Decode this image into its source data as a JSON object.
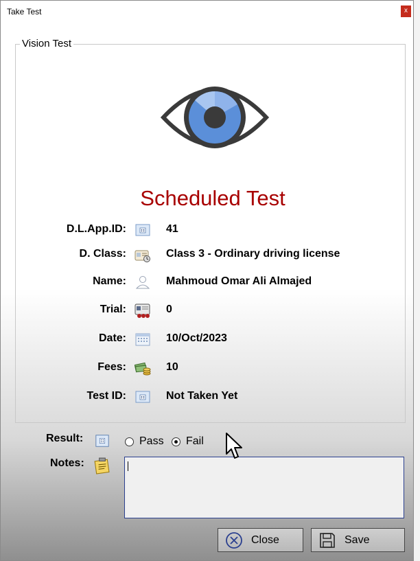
{
  "window": {
    "title": "Take Test",
    "close_glyph": "x"
  },
  "group": {
    "label": "Vision Test"
  },
  "heading": "Scheduled Test",
  "rows": [
    {
      "label": "D.L.App.ID:",
      "icon": "id-card-icon",
      "value": "41"
    },
    {
      "label": "D. Class:",
      "icon": "license-class-icon",
      "value": "Class 3 - Ordinary driving license"
    },
    {
      "label": "Name:",
      "icon": "person-icon",
      "value": "Mahmoud Omar Ali Almajed"
    },
    {
      "label": "Trial:",
      "icon": "trial-icon",
      "value": "0"
    },
    {
      "label": "Date:",
      "icon": "calendar-icon",
      "value": "10/Oct/2023"
    },
    {
      "label": "Fees:",
      "icon": "money-icon",
      "value": "10"
    },
    {
      "label": "Test ID:",
      "icon": "id-card-icon",
      "value": "Not Taken Yet"
    }
  ],
  "result": {
    "label": "Result:",
    "options": [
      {
        "label": "Pass",
        "selected": false
      },
      {
        "label": "Fail",
        "selected": true
      }
    ]
  },
  "notes": {
    "label": "Notes:",
    "value": ""
  },
  "buttons": {
    "close_label": "Close",
    "save_label": "Save"
  },
  "colors": {
    "heading": "#a80000",
    "eye_iris": "#5b8fd9",
    "notes_border": "#2a3f8f"
  }
}
